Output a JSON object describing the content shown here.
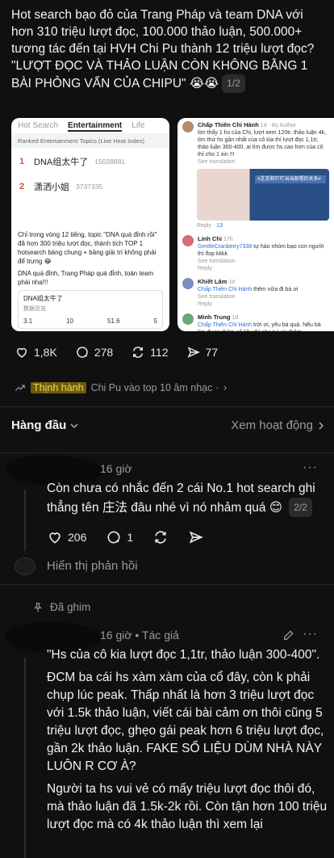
{
  "post": {
    "paragraph1": "Hot search bạo đỏ của Trang Pháp và team DNA với hơn 310 triệu lượt đọc, 100.000 thảo luận, 500.000+ tương tác đến tại HVH Chi Pu thành 12 triệu lượt đọc?",
    "paragraph2": "\"LƯỢT ĐỌC VÀ THẢO LUẬN CÒN KHÔNG BẰNG 1 BÀI PHỎNG VẤN CỦA CHIPU\"",
    "emoji": "😭😭",
    "page_indicator": "1/2"
  },
  "media1": {
    "tabs": [
      "Hot Search",
      "Entertainment",
      "Life"
    ],
    "header": "Ranked Entertainment Topics (Live Heat Index)",
    "rows": [
      {
        "rank": "1",
        "title": "DNA组太牛了",
        "count": "15038881"
      },
      {
        "rank": "2",
        "title": "潇洒小姐",
        "count": "3737335"
      }
    ],
    "body1": "Chỉ trong vòng 12 tiếng, topic \"DNA quá đỉnh rồi\" đã hơn 300 triệu lượt đọc, thành tích TOP 1 hotsearch bảng chung + bảng giải trí không phải để trưng 😂",
    "body2": "DNA quá đỉnh, Trang Pháp quá đỉnh, toàn team phải nha!!!",
    "card_title": "DNA组太牛了",
    "card_sub": "数据总览",
    "stats": [
      "3.1",
      "10",
      "51.6",
      "5"
    ]
  },
  "media2": {
    "author": "Chấp Thiên Chỉ Hành",
    "author_meta": "1d · By Author",
    "author_text": "tìm thấy 1 hs của Chi, lượt xem 120tr, thảo luận 4k, tìm thử hs gần nhất của cô kia thì lượt đọc 1,1tr, thảo luận 300-400, ai tìm được hs cao hơn của cô thì cho 1 xin !!!",
    "see_translation": "See translation",
    "image_caption": "#芝芙和叮叮当当原唱的关系#",
    "reply_label": "Reply",
    "like_count": "13",
    "c1_name": "Linh Chi",
    "c1_meta": "17h",
    "c1_mention": "GentleCranberry7338",
    "c1_text": "tự hào nhóm bạo con người thì flop kkkk",
    "c2_name": "Khiết Lâm",
    "c2_meta": "1d",
    "c2_mention": "Chấp Thiên Chỉ Hành",
    "c2_text": "thêm nữa đi bà ơi",
    "c3_name": "Minh Trung",
    "c3_meta": "1d",
    "c3_mention": "Chấp Thiên Chỉ Hành",
    "c3_text": "trời ơi, yêu bà quá. Nếu bà tìm được thêm số liệu thì cho tui xin thêm"
  },
  "post_actions": {
    "likes": "1,8K",
    "comments": "278",
    "reposts": "112",
    "shares": "77"
  },
  "trending": {
    "tag": "Thịnh hành",
    "text": "Chi Pu vào top 10 âm nhạc ·",
    "chevron": "›"
  },
  "sort": {
    "left": "Hàng đầu",
    "right": "Xem hoạt động"
  },
  "comment1": {
    "time": "16 giờ",
    "more": "···",
    "text": "Còn chưa có nhắc đến 2 cái No.1 hot search ghi thẳng tên 庄法 đâu nhé vì nó nhảm quá",
    "emoji": "😊",
    "page_indicator": "2/2",
    "likes": "206",
    "replies": "1"
  },
  "show_replies": "Hiển thị phản hồi",
  "pinned": "Đã ghim",
  "comment2": {
    "time": "16 giờ • Tác giả",
    "more": "···",
    "p1": "\"Hs của cô kia lượt đọc 1,1tr, thảo luận 300-400\".",
    "p2": "ĐCM ba cái hs xàm xàm của cổ đây, còn k phải chụp lúc peak. Thấp nhất là hơn 3 triệu lượt đọc với 1.5k thảo luận, viết cái bài cảm ơn thôi cũng 5 triệu lượt đọc, ghẹo gái peak hơn 6 triệu lượt đọc, gần 2k thảo luận. FAKE SỐ LIỆU DÙM NHÀ NÀY LUÔN R CƠ À?",
    "p3": "Người ta hs vui vẻ có mấy triệu lượt đọc thôi đó, mà thảo luận đã 1.5k-2k rồi. Còn tận hơn 100 triệu lượt đọc mà có 4k thảo luận thì xem lại"
  }
}
